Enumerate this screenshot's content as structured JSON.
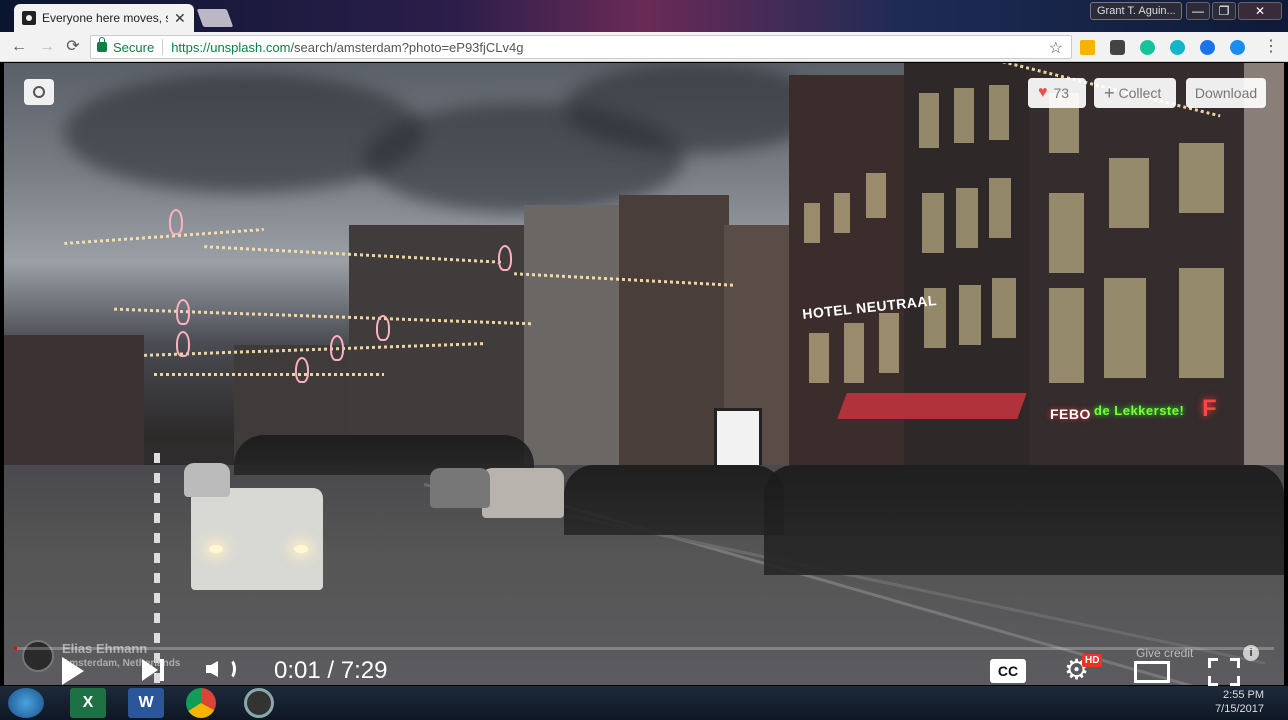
{
  "browser": {
    "tab_title": "Everyone here moves, so",
    "tab_close": "✕",
    "profile_name": "Grant T. Aguin...",
    "window_controls": {
      "minimize": "—",
      "maximize": "❐",
      "close": "✕"
    },
    "nav": {
      "back": "←",
      "forward": "→",
      "reload": "⟳"
    },
    "address": {
      "secure_label": "Secure",
      "url_scheme_host": "https://unsplash.com",
      "url_path": "/search/amsterdam?photo=eP93fjCLv4g"
    },
    "bookmark_star": "☆",
    "extensions": [
      "extension-icon",
      "pocket-icon",
      "grammarly-icon",
      "extension-m-icon",
      "extension-refresh-icon",
      "extension-toggle-icon"
    ],
    "menu": "⋮"
  },
  "photo_page": {
    "like_count": "73",
    "like_icon": "♥",
    "collect_label": "Collect",
    "collect_icon": "+",
    "download_label": "Download",
    "author_name": "Elias Ehmann",
    "author_location": "Amsterdam, Netherlands",
    "give_credit": "Give credit",
    "info_icon": "i",
    "signs": [
      "HOTEL NEUTRAAL",
      "FEBO",
      "de Lekkerste!",
      "F",
      "HOTEL NEUTRAAL"
    ]
  },
  "player": {
    "time": "0:01 / 7:29",
    "progress": 0.002,
    "cc_label": "CC",
    "hd_badge": "HD",
    "gear_icon": "⚙",
    "colors": {
      "progress": "#ff0000",
      "hd": "#ee3322"
    }
  },
  "taskbar": {
    "apps": [
      "start-icon",
      "excel-icon",
      "word-icon",
      "chrome-icon",
      "media-player-icon"
    ],
    "excel_letter": "X",
    "word_letter": "W",
    "clock_time": "2:55 PM",
    "clock_date": "7/15/2017"
  },
  "colors": {
    "secure_green": "#0b8043",
    "heart": "#e4534f"
  }
}
